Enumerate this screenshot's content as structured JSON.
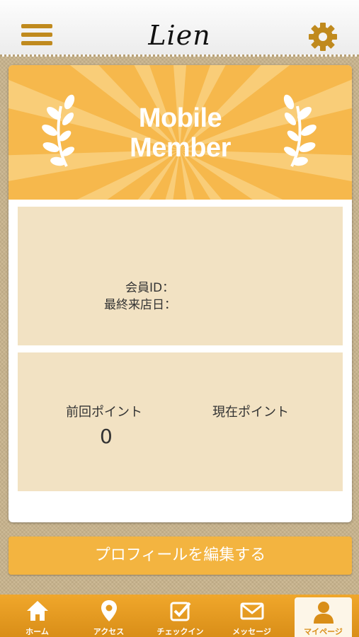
{
  "header": {
    "title": "Lien",
    "menu_icon": "hamburger-menu-icon",
    "settings_icon": "gear-icon"
  },
  "banner": {
    "title_line1": "Mobile",
    "title_line2": "Member",
    "colors": {
      "background": "#f6b84c",
      "rays": "#f9cd78"
    }
  },
  "member_info": {
    "id_label": "会員ID：",
    "last_visit_label": "最終来店日："
  },
  "points": {
    "previous_label": "前回ポイント",
    "previous_value": "0",
    "current_label": "現在ポイント"
  },
  "edit_profile_label": "プロフィールを編集する",
  "tabbar": {
    "tabs": [
      {
        "label": "ホーム",
        "icon": "home-icon"
      },
      {
        "label": "アクセス",
        "icon": "map-pin-icon"
      },
      {
        "label": "チェックイン",
        "icon": "checkbox-icon"
      },
      {
        "label": "メッセージ",
        "icon": "envelope-icon"
      },
      {
        "label": "マイページ",
        "icon": "user-icon",
        "active": true
      }
    ]
  },
  "colors": {
    "accent": "#f3b440",
    "panel": "#f2e2c3"
  }
}
